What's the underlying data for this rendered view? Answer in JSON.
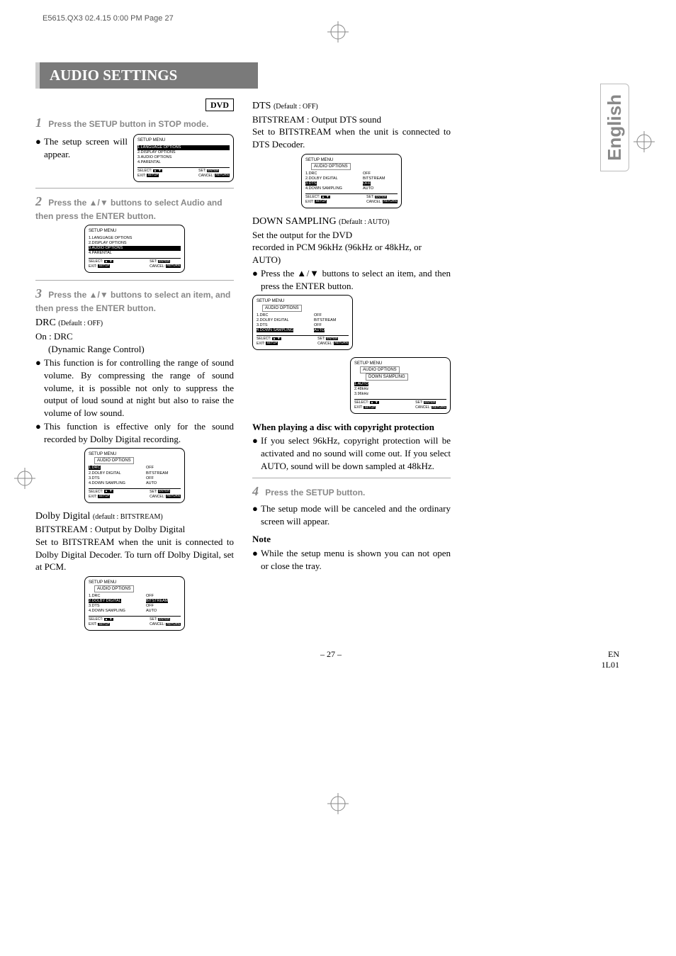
{
  "header_run": "E5615.QX3  02.4.15 0:00 PM  Page 27",
  "title": "AUDIO SETTINGS",
  "badge": "DVD",
  "language_tab": "English",
  "steps": {
    "s1": {
      "num": "1",
      "text": "Press the SETUP button in STOP mode."
    },
    "s2": {
      "num": "2",
      "text": "Press the ▲/▼ buttons to select Audio and then press the ENTER button."
    },
    "s3": {
      "num": "3",
      "text": "Press the ▲/▼ buttons to select an item, and then press the ENTER button."
    },
    "s4": {
      "num": "4",
      "text": "Press the SETUP button."
    }
  },
  "bullets": {
    "b1": "The setup screen will appear.",
    "b_drc1": "This function is for controlling the range of sound volume. By compressing the range of sound volume, it is possible not only to suppress the output of loud sound at night but also to raise the volume of low sound.",
    "b_drc2": "This function is effective only for the sound recorded by Dolby Digital recording.",
    "b_down": "Press the ▲/▼ buttons to select an item, and then press the ENTER button.",
    "b_copy": "If you select 96kHz, copyright protection will be activated and no sound will come out. If you select AUTO, sound will be down sampled at 48kHz.",
    "b_cancel": "The setup mode will be canceled and the ordinary screen will appear.",
    "b_note": "While the setup menu is shown you can not open or close the tray."
  },
  "headings": {
    "drc_head": "DRC ",
    "drc_def": "(Default : OFF)",
    "on_drc": "On : DRC",
    "dyn": "(Dynamic Range Control)",
    "dolby_head": "Dolby Digital ",
    "dolby_def": "(default : BITSTREAM)",
    "dolby_l1": "BITSTREAM : Output by Dolby Digital",
    "dolby_l2": "Set to BITSTREAM when the unit is connected to Dolby Digital Decoder. To turn off Dolby Digital, set at PCM.",
    "dts_head": "DTS ",
    "dts_def": "(Default : OFF)",
    "dts_l1": "BITSTREAM : Output DTS sound",
    "dts_l2": "Set to BITSTREAM when the unit is connected to DTS Decoder.",
    "down_head": "DOWN SAMPLING ",
    "down_def": "(Default : AUTO)",
    "down_l1": "Set the output for the DVD",
    "down_l2": "recorded in PCM 96kHz (96kHz or 48kHz, or AUTO)",
    "copy_head": "When playing a disc with copyright protection",
    "note_head": "Note"
  },
  "osd": {
    "setup_menu": "SETUP MENU",
    "audio_options": "AUDIO OPTIONS",
    "down_sampling": "DOWN SAMPLING",
    "main_items": [
      "1.LANGUAGE OPTIONS",
      "2.DISPLAY OPTIONS",
      "3.AUDIO OPTIONS",
      "4.PARENTAL"
    ],
    "audio_items": [
      {
        "l": "1.DRC",
        "r": "OFF"
      },
      {
        "l": "2.DOLBY DIGITAL",
        "r": "BITSTREAM"
      },
      {
        "l": "3.DTS",
        "r": "OFF"
      },
      {
        "l": "4.DOWN SAMPLING",
        "r": "AUTO"
      }
    ],
    "ds_items": [
      "1.AUTO",
      "2.48kHz",
      "3.96kHz"
    ],
    "ft_select": "SELECT:",
    "ft_exit": "EXIT:",
    "ft_set": "SET:",
    "ft_cancel": "CANCEL:",
    "k_setup": "SETUP",
    "k_enter": "ENTER",
    "k_return": "RETURN"
  },
  "footer": {
    "page": "– 27 –",
    "code1": "EN",
    "code2": "1L01"
  }
}
